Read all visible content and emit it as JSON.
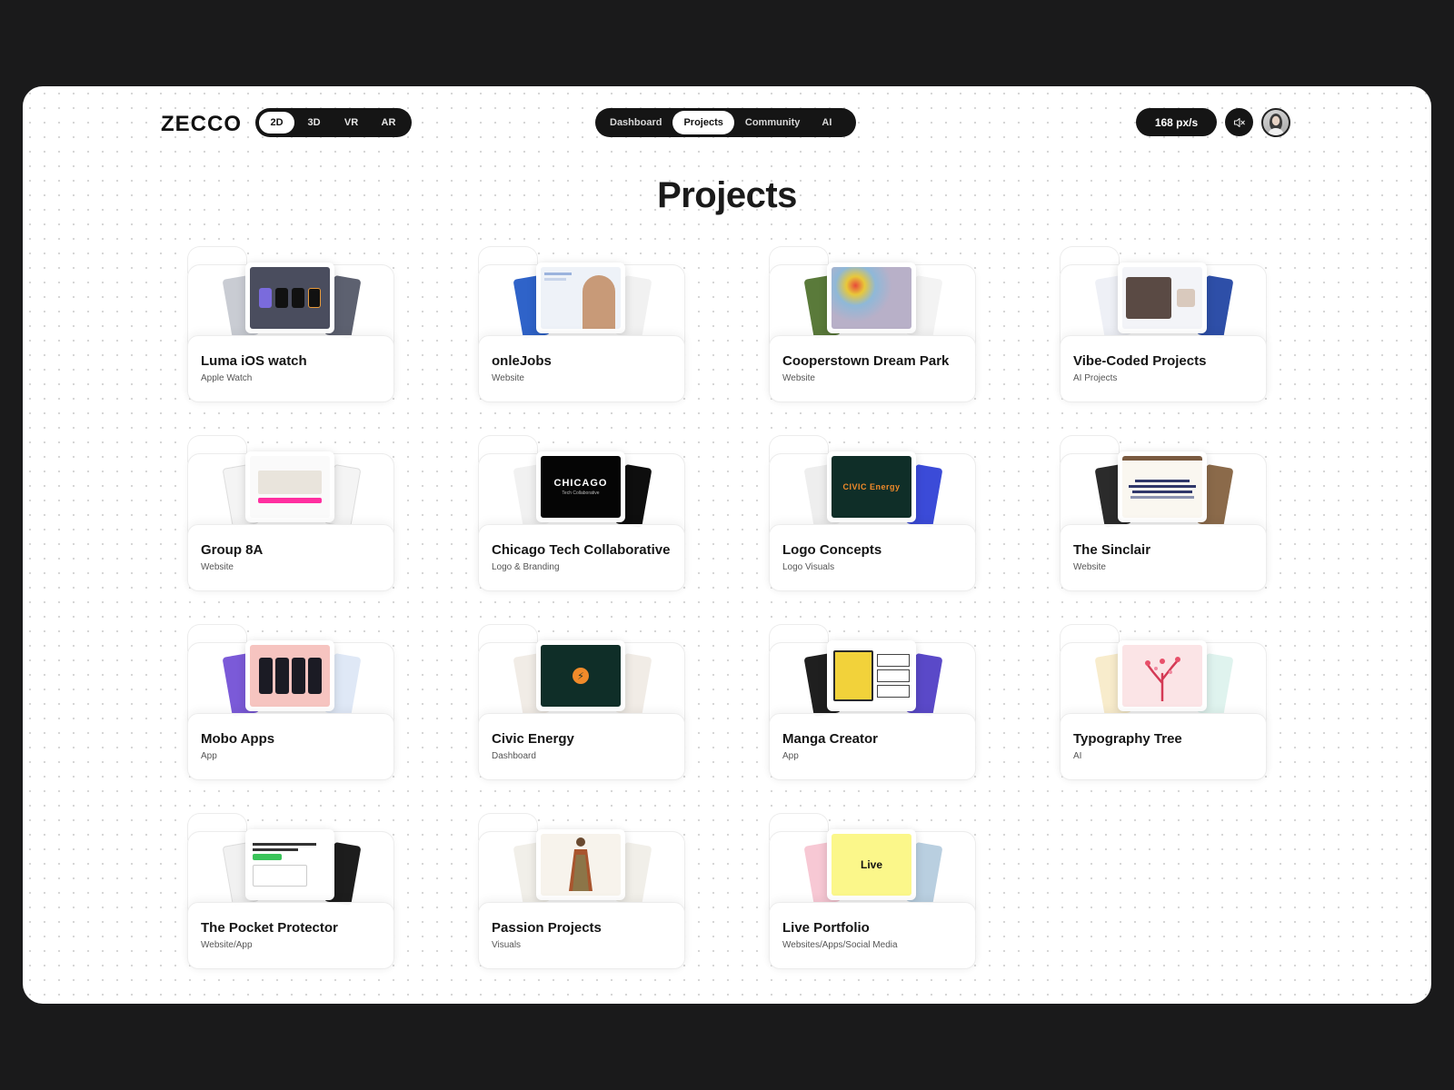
{
  "brand": {
    "logo": "ZECCO"
  },
  "modes": [
    "2D",
    "3D",
    "VR",
    "AR"
  ],
  "nav": [
    "Dashboard",
    "Projects",
    "Community",
    "AI"
  ],
  "speed": "168 px/s",
  "page": {
    "title": "Projects"
  },
  "projects": [
    {
      "name": "Luma iOS watch",
      "category": "Apple Watch"
    },
    {
      "name": "onleJobs",
      "category": "Website"
    },
    {
      "name": "Cooperstown Dream Park",
      "category": "Website"
    },
    {
      "name": "Vibe-Coded Projects",
      "category": "AI Projects"
    },
    {
      "name": "Group 8A",
      "category": "Website"
    },
    {
      "name": "Chicago Tech Collaborative",
      "category": "Logo & Branding",
      "thumb_text": "CHICAGO",
      "thumb_sub": "Tech Collaborative"
    },
    {
      "name": "Logo Concepts",
      "category": "Logo Visuals",
      "thumb_text": "CIVIC Energy"
    },
    {
      "name": "The Sinclair",
      "category": "Website"
    },
    {
      "name": "Mobo Apps",
      "category": "App"
    },
    {
      "name": "Civic Energy",
      "category": "Dashboard"
    },
    {
      "name": "Manga Creator",
      "category": "App"
    },
    {
      "name": "Typography Tree",
      "category": "AI"
    },
    {
      "name": "The Pocket Protector",
      "category": "Website/App"
    },
    {
      "name": "Passion Projects",
      "category": "Visuals"
    },
    {
      "name": "Live Portfolio",
      "category": "Websites/Apps/Social Media",
      "thumb_text": "Live"
    }
  ]
}
